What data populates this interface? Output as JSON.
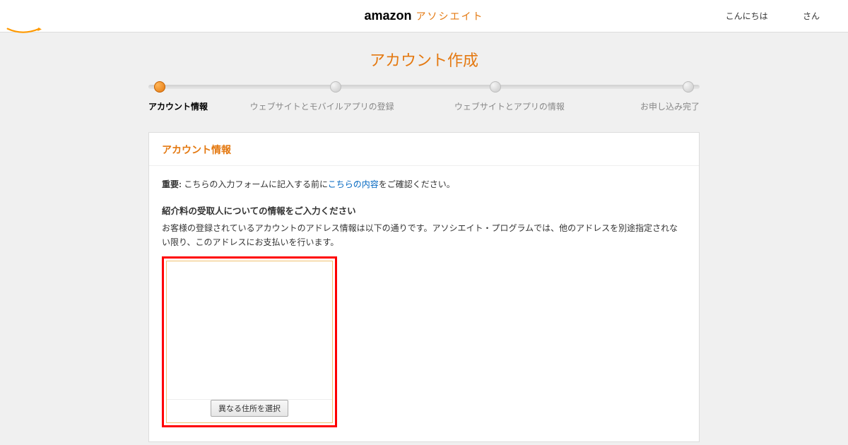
{
  "header": {
    "logo_primary": "amazon",
    "logo_secondary": "アソシエイト",
    "greeting_prefix": "こんにちは",
    "greeting_suffix": "さん"
  },
  "page_title": "アカウント作成",
  "progress": {
    "steps": [
      {
        "label": "アカウント情報",
        "active": true
      },
      {
        "label": "ウェブサイトとモバイルアプリの登録",
        "active": false
      },
      {
        "label": "ウェブサイトとアプリの情報",
        "active": false
      },
      {
        "label": "お申し込み完了",
        "active": false
      }
    ]
  },
  "card": {
    "header": "アカウント情報",
    "important_label": "重要:",
    "important_before": " こちらの入力フォームに記入する前に",
    "important_link": "こちらの内容",
    "important_after": "をご確認ください。",
    "section_title": "紹介料の受取人についての情報をご入力ください",
    "section_desc": "お客様の登録されているアカウントのアドレス情報は以下の通りです。アソシエイト・プログラムでは、他のアドレスを別途指定されない限り、このアドレスにお支払いを行います。",
    "select_button": "異なる住所を選択"
  }
}
